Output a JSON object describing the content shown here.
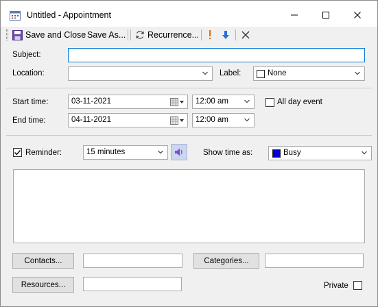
{
  "window": {
    "title": "Untitled - Appointment"
  },
  "toolbar": {
    "save_close": "Save and Close",
    "save_as": "Save As...",
    "recurrence": "Recurrence..."
  },
  "form": {
    "subject_label": "Subject:",
    "subject_value": "",
    "location_label": "Location:",
    "location_value": "",
    "label_label": "Label:",
    "label_value": "None",
    "start_time_label": "Start time:",
    "start_date": "03-11-2021",
    "start_clock": "12:00 am",
    "end_time_label": "End time:",
    "end_date": "04-11-2021",
    "end_clock": "12:00 am",
    "all_day_label": "All day event",
    "reminder_label": "Reminder:",
    "reminder_value": "15 minutes",
    "show_time_label": "Show time as:",
    "show_time_value": "Busy",
    "notes": ""
  },
  "buttons": {
    "contacts": "Contacts...",
    "categories": "Categories...",
    "resources": "Resources..."
  },
  "private_label": "Private",
  "colors": {
    "busy": "#0000d0",
    "importance_high": "#e07000",
    "importance_low": "#2a6fd6",
    "focus": "#0078d7"
  }
}
